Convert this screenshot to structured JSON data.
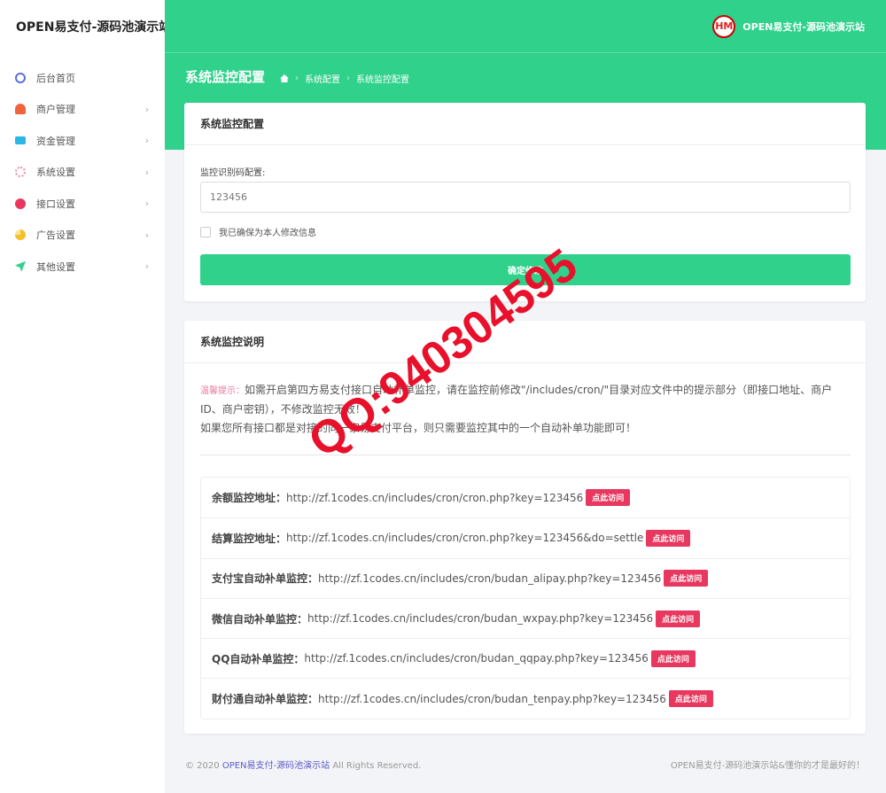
{
  "brand": "OPEN易支付-源码池演示站",
  "sidebar": {
    "items": [
      {
        "label": "后台首页",
        "icon": "compass-icon",
        "color": "#5b6fd8",
        "chevron": ""
      },
      {
        "label": "商户管理",
        "icon": "user-icon",
        "color": "#f0643c",
        "chevron": "›"
      },
      {
        "label": "资金管理",
        "icon": "card-icon",
        "color": "#2bb6e8",
        "chevron": "›"
      },
      {
        "label": "系统设置",
        "icon": "gear-icon",
        "color": "#f08ca4",
        "chevron": "›"
      },
      {
        "label": "接口设置",
        "icon": "plug-icon",
        "color": "#e8385f",
        "chevron": "›"
      },
      {
        "label": "广告设置",
        "icon": "pie-chart-icon",
        "color": "#f5c02a",
        "chevron": "›"
      },
      {
        "label": "其他设置",
        "icon": "send-icon",
        "color": "#2fd18b",
        "chevron": "›"
      }
    ]
  },
  "topbar": {
    "logo_text": "HM",
    "site_name": "OPEN易支付-源码池演示站"
  },
  "header": {
    "title": "系统监控配置",
    "breadcrumb": [
      "系统配置",
      "系统监控配置"
    ]
  },
  "config_card": {
    "title": "系统监控配置",
    "field_label": "监控识别码配置:",
    "field_value": "123456",
    "confirm_text": "我已确保为本人修改信息",
    "submit_label": "确定修改"
  },
  "info_card": {
    "title": "系统监控说明",
    "tip_label": "温馨提示：",
    "tip_line1": "如需开启第四方易支付接口自动补单监控，请在监控前修改\"/includes/cron/\"目录对应文件中的提示部分（即接口地址、商户ID、商户密钥），不修改监控无效！",
    "tip_line2": "如果您所有接口都是对接的同一家易支付平台，则只需要监控其中的一个自动补单功能即可！",
    "monitors": [
      {
        "name": "余额监控地址：",
        "url": "http://zf.1codes.cn/includes/cron/cron.php?key=123456",
        "button": "点此访问"
      },
      {
        "name": "结算监控地址：",
        "url": "http://zf.1codes.cn/includes/cron/cron.php?key=123456&do=settle",
        "button": "点此访问"
      },
      {
        "name": "支付宝自动补单监控：",
        "url": "http://zf.1codes.cn/includes/cron/budan_alipay.php?key=123456",
        "button": "点此访问"
      },
      {
        "name": "微信自动补单监控：",
        "url": "http://zf.1codes.cn/includes/cron/budan_wxpay.php?key=123456",
        "button": "点此访问"
      },
      {
        "name": "QQ自动补单监控：",
        "url": "http://zf.1codes.cn/includes/cron/budan_qqpay.php?key=123456",
        "button": "点此访问"
      },
      {
        "name": "财付通自动补单监控：",
        "url": "http://zf.1codes.cn/includes/cron/budan_tenpay.php?key=123456",
        "button": "点此访问"
      }
    ]
  },
  "footer": {
    "copyright_prefix": "© 2020",
    "brand": "OPEN易支付-源码池演示站",
    "rights": "All Rights Reserved.",
    "right_text": "OPEN易支付-源码池演示站&懂你的才是最好的！"
  },
  "watermark": {
    "text": "QQ:940304595",
    "color": "#e8102a"
  },
  "colors": {
    "accent": "#2fd18b",
    "danger": "#e8385f",
    "link": "#5b5bc8"
  }
}
